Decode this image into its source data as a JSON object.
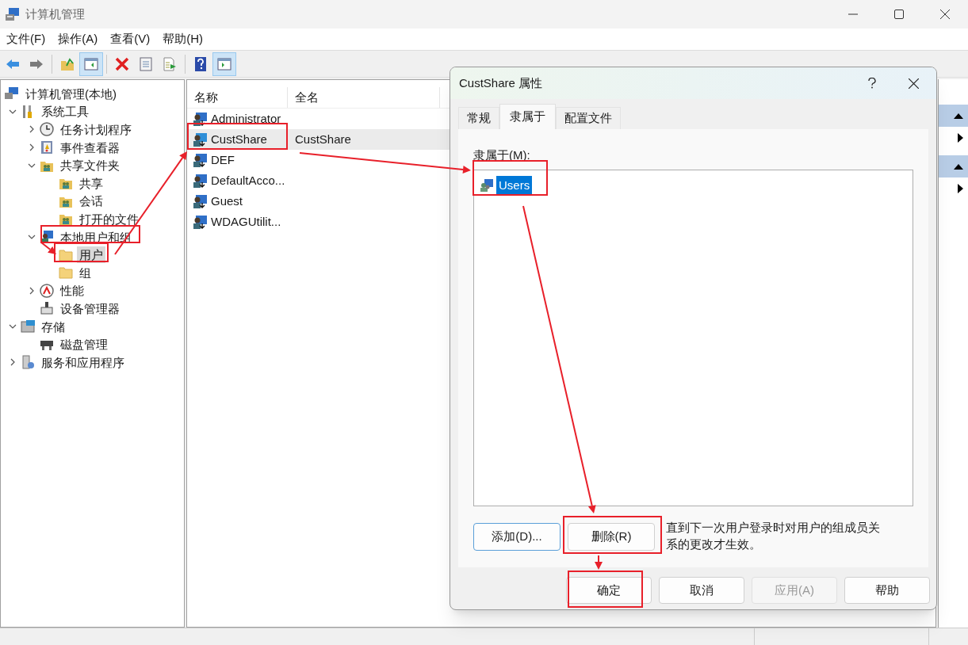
{
  "window": {
    "title": "计算机管理"
  },
  "menu": [
    "文件(F)",
    "操作(A)",
    "查看(V)",
    "帮助(H)"
  ],
  "toolbar_groups": [
    [
      {
        "kind": "back",
        "pressed": false
      },
      {
        "kind": "forward",
        "pressed": false
      }
    ],
    [
      {
        "kind": "up",
        "pressed": false
      },
      {
        "kind": "tree-pane",
        "pressed": true
      }
    ],
    [
      {
        "kind": "delete",
        "pressed": false
      },
      {
        "kind": "properties",
        "pressed": false
      },
      {
        "kind": "export",
        "pressed": false
      }
    ],
    [
      {
        "kind": "help",
        "pressed": false
      },
      {
        "kind": "action-pane",
        "pressed": true
      }
    ]
  ],
  "tree": [
    {
      "label": "计算机管理(本地)",
      "kind": "computer",
      "selected": false,
      "children": [
        {
          "label": "系统工具",
          "kind": "tools",
          "expanded": true,
          "selected": false,
          "children": [
            {
              "label": "任务计划程序",
              "kind": "clock",
              "expanded": false,
              "selected": false
            },
            {
              "label": "事件查看器",
              "kind": "eventlog",
              "expanded": false,
              "selected": false
            },
            {
              "label": "共享文件夹",
              "kind": "share",
              "expanded": true,
              "selected": false,
              "children": [
                {
                  "label": "共享",
                  "kind": "share",
                  "selected": false
                },
                {
                  "label": "会话",
                  "kind": "share",
                  "selected": false
                },
                {
                  "label": "打开的文件",
                  "kind": "share",
                  "selected": false
                }
              ]
            },
            {
              "label": "本地用户和组",
              "kind": "users",
              "expanded": true,
              "selected": false,
              "children": [
                {
                  "label": "用户",
                  "kind": "folder",
                  "selected": true
                },
                {
                  "label": "组",
                  "kind": "folder",
                  "selected": false
                }
              ]
            },
            {
              "label": "性能",
              "kind": "perf",
              "expanded": false,
              "selected": false
            },
            {
              "label": "设备管理器",
              "kind": "device",
              "selected": false
            }
          ]
        },
        {
          "label": "存储",
          "kind": "storage",
          "expanded": true,
          "selected": false,
          "children": [
            {
              "label": "磁盘管理",
              "kind": "disk",
              "selected": false
            }
          ]
        },
        {
          "label": "服务和应用程序",
          "kind": "services",
          "expanded": false,
          "selected": false
        }
      ]
    }
  ],
  "list": {
    "columns": [
      "名称",
      "全名"
    ],
    "rows": [
      {
        "name": "Administrator",
        "full_name": "",
        "selected": false
      },
      {
        "name": "CustShare",
        "full_name": "CustShare",
        "selected": true
      },
      {
        "name": "DEF",
        "full_name": "",
        "selected": false
      },
      {
        "name": "DefaultAcco...",
        "full_name": "",
        "selected": false
      },
      {
        "name": "Guest",
        "full_name": "",
        "selected": false
      },
      {
        "name": "WDAGUtilit...",
        "full_name": "",
        "selected": false
      }
    ]
  },
  "dialog": {
    "title": "CustShare 属性",
    "tabs": [
      {
        "label": "常规",
        "selected": false
      },
      {
        "label": "隶属于",
        "selected": true
      },
      {
        "label": "配置文件",
        "selected": false
      }
    ],
    "member_label": "隶属于(M):",
    "members": [
      {
        "name": "Users",
        "selected": true
      }
    ],
    "add_button": "添加(D)...",
    "remove_button": "删除(R)",
    "note": "直到下一次用户登录时对用户的组成员关系的更改才生效。",
    "buttons": [
      {
        "label": "确定",
        "disabled": false
      },
      {
        "label": "取消",
        "disabled": false
      },
      {
        "label": "应用(A)",
        "disabled": true
      },
      {
        "label": "帮助",
        "disabled": false
      }
    ]
  }
}
